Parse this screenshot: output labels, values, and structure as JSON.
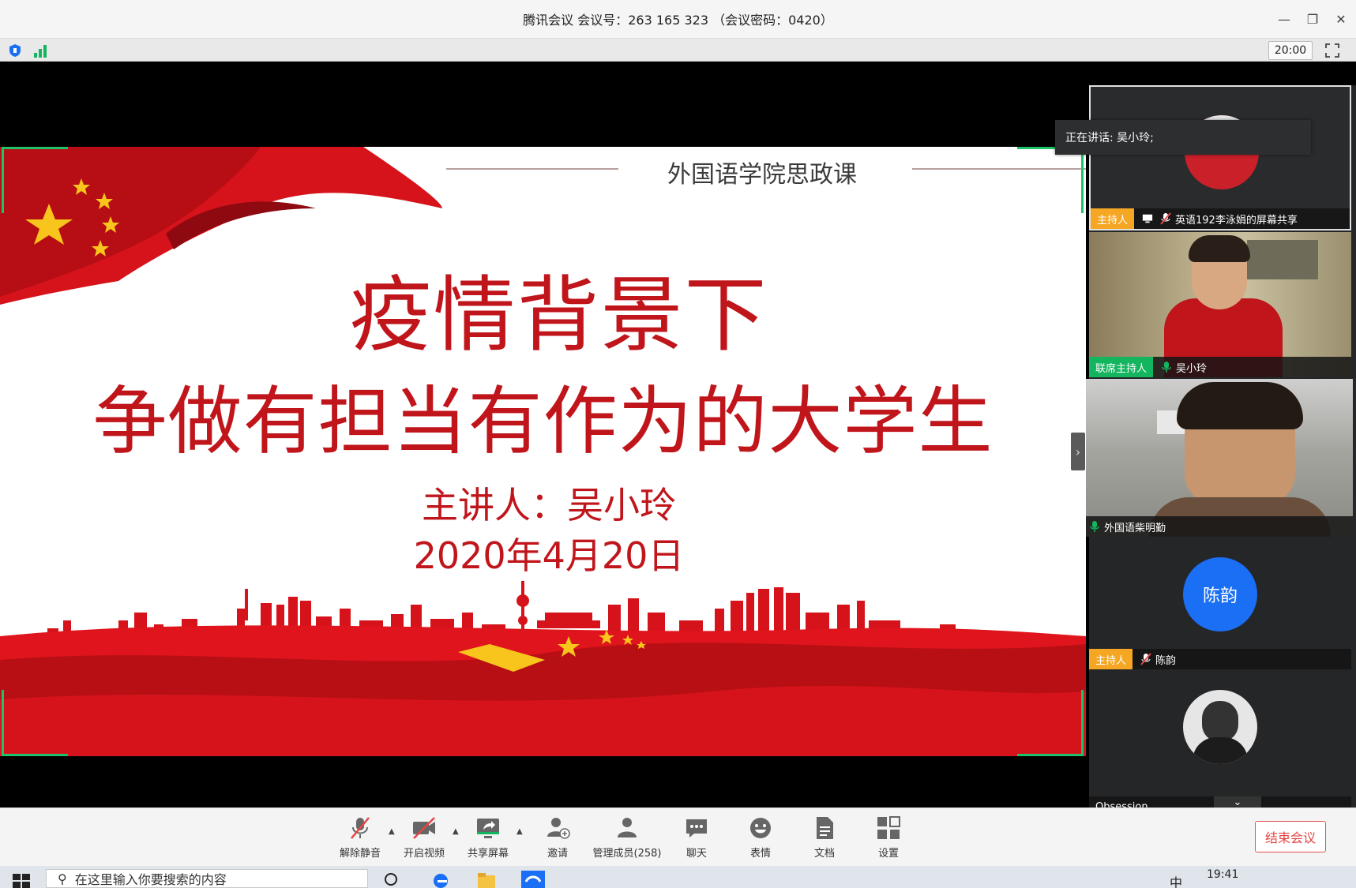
{
  "window": {
    "title": "腾讯会议 会议号：263 165 323  （会议密码：0420）",
    "controls": {
      "minimize": "—",
      "restore": "❐",
      "close": "✕"
    }
  },
  "infobar": {
    "timer": "20:00"
  },
  "slide": {
    "course_title": "外国语学院思政课",
    "main_title_line1": "疫情背景下",
    "main_title_line2": "争做有担当有作为的大学生",
    "speaker": "主讲人：吴小玲",
    "date": "2020年4月20日"
  },
  "speaking_indicator": "正在讲话: 吴小玲;",
  "participants": [
    {
      "badge": "主持人",
      "badge_type": "host",
      "name": "英语192李泳娟的屏幕共享"
    },
    {
      "badge": "联席主持人",
      "badge_type": "cohost",
      "name": "吴小玲"
    },
    {
      "badge": "",
      "badge_type": "",
      "name": "外国语柴明勤"
    },
    {
      "badge": "主持人",
      "badge_type": "host",
      "name": "陈韵",
      "avatar_text": "陈韵"
    },
    {
      "badge": "",
      "badge_type": "",
      "name": "Obsession"
    }
  ],
  "toolbar": {
    "unmute": "解除静音",
    "video": "开启视频",
    "share": "共享屏幕",
    "invite": "邀请",
    "members": "管理成员(258)",
    "chat": "聊天",
    "emoji": "表情",
    "docs": "文档",
    "settings": "设置",
    "end": "结束会议"
  },
  "taskbar": {
    "search_placeholder": "在这里输入你要搜索的内容",
    "time": "19:41",
    "ime": "中"
  },
  "colors": {
    "slide_red": "#c0151b",
    "host_badge": "#f5a623",
    "cohost_badge": "#13b55f",
    "avatar_blue": "#1a6ff5",
    "share_border": "#1ec26a",
    "end_button": "#e64545"
  }
}
